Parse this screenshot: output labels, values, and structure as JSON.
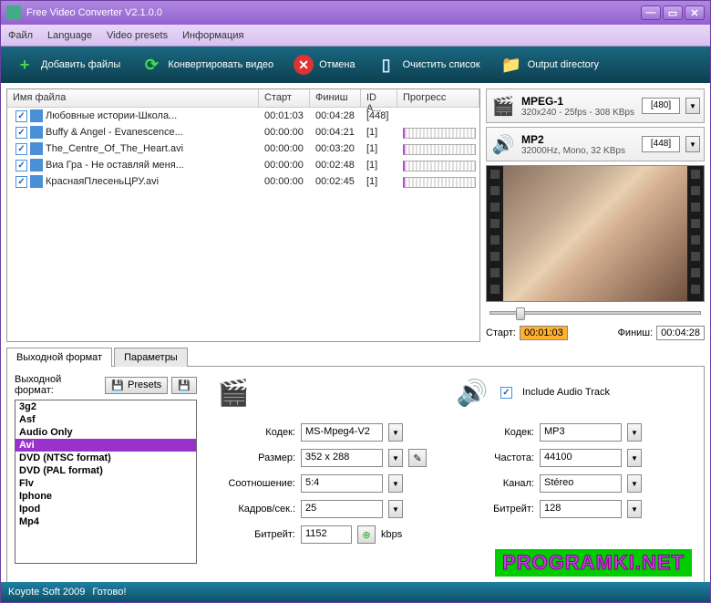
{
  "window": {
    "title": "Free Video Converter V2.1.0.0"
  },
  "menu": [
    "Файл",
    "Language",
    "Video presets",
    "Информация"
  ],
  "toolbar": {
    "add": "Добавить файлы",
    "convert": "Конвертировать видео",
    "cancel": "Отмена",
    "clear": "Очистить список",
    "outdir": "Output directory"
  },
  "columns": {
    "name": "Имя файла",
    "start": "Старт",
    "end": "Финиш",
    "id": "ID A...",
    "prog": "Прогресс"
  },
  "files": [
    {
      "name": "Любовные истории-Школа...",
      "start": "00:01:03",
      "end": "00:04:28",
      "id": "[448]"
    },
    {
      "name": "Buffy & Angel - Evanescence...",
      "start": "00:00:00",
      "end": "00:04:21",
      "id": "[1]"
    },
    {
      "name": "The_Centre_Of_The_Heart.avi",
      "start": "00:00:00",
      "end": "00:03:20",
      "id": "[1]"
    },
    {
      "name": "Виа Гра - Не оставляй меня...",
      "start": "00:00:00",
      "end": "00:02:48",
      "id": "[1]"
    },
    {
      "name": "КраснаяПлесеньЦРУ.avi",
      "start": "00:00:00",
      "end": "00:02:45",
      "id": "[1]"
    }
  ],
  "video_format": {
    "name": "MPEG-1",
    "details": "320x240 - 25fps - 308 KBps",
    "sel": "[480]"
  },
  "audio_format": {
    "name": "MP2",
    "details": "32000Hz, Mono, 32 KBps",
    "sel": "[448]"
  },
  "time": {
    "start_label": "Старт:",
    "start": "00:01:03",
    "end_label": "Финиш:",
    "end": "00:04:28"
  },
  "tabs": {
    "output": "Выходной формат",
    "params": "Параметры"
  },
  "out_label": "Выходной формат:",
  "presets_btn": "Presets",
  "formats": [
    "3g2",
    "Asf",
    "Audio Only",
    "Avi",
    "DVD (NTSC format)",
    "DVD (PAL format)",
    "Flv",
    "Iphone",
    "Ipod",
    "Mp4"
  ],
  "formats_selected": "Avi",
  "video_params": {
    "codec_l": "Кодек:",
    "codec": "MS-Mpeg4-V2",
    "size_l": "Размер:",
    "size": "352 x 288",
    "ratio_l": "Соотношение:",
    "ratio": "5:4",
    "fps_l": "Кадров/сек.:",
    "fps": "25",
    "bitrate_l": "Битрейт:",
    "bitrate": "1152",
    "bitrate_u": "kbps"
  },
  "audio_params": {
    "include": "Include Audio Track",
    "codec_l": "Кодек:",
    "codec": "MP3",
    "freq_l": "Частота:",
    "freq": "44100",
    "chan_l": "Канал:",
    "chan": "Stéreo",
    "bitrate_l": "Битрейт:",
    "bitrate": "128"
  },
  "status": {
    "left": "Koyote Soft 2009",
    "right": "Готово!"
  },
  "watermark": "PROGRAMKI.NET"
}
